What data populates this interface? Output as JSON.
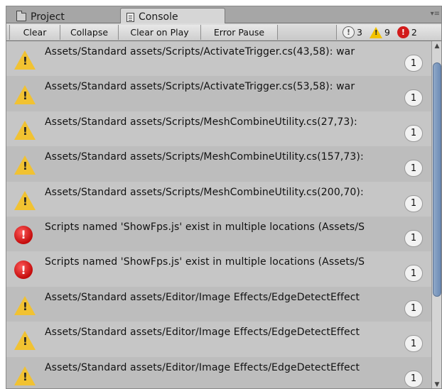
{
  "tabs": {
    "project": "Project",
    "console": "Console",
    "menu_glyph": "▾≡"
  },
  "toolbar": {
    "clear": "Clear",
    "collapse": "Collapse",
    "clear_on_play": "Clear on Play",
    "error_pause": "Error Pause"
  },
  "counts": {
    "info": "3",
    "warning": "9",
    "error": "2"
  },
  "logs": [
    {
      "type": "warning",
      "text": "Assets/Standard assets/Scripts/ActivateTrigger.cs(43,58): war",
      "count": "1"
    },
    {
      "type": "warning",
      "text": "Assets/Standard assets/Scripts/ActivateTrigger.cs(53,58): war",
      "count": "1"
    },
    {
      "type": "warning",
      "text": "Assets/Standard assets/Scripts/MeshCombineUtility.cs(27,73):",
      "count": "1"
    },
    {
      "type": "warning",
      "text": "Assets/Standard assets/Scripts/MeshCombineUtility.cs(157,73):",
      "count": "1"
    },
    {
      "type": "warning",
      "text": "Assets/Standard assets/Scripts/MeshCombineUtility.cs(200,70):",
      "count": "1"
    },
    {
      "type": "error",
      "text": "Scripts named 'ShowFps.js' exist in multiple locations (Assets/S",
      "count": "1"
    },
    {
      "type": "error",
      "text": "Scripts named 'ShowFps.js' exist in multiple locations (Assets/S",
      "count": "1"
    },
    {
      "type": "warning",
      "text": "Assets/Standard assets/Editor/Image Effects/EdgeDetectEffect",
      "count": "1"
    },
    {
      "type": "warning",
      "text": "Assets/Standard assets/Editor/Image Effects/EdgeDetectEffect",
      "count": "1"
    },
    {
      "type": "warning",
      "text": "Assets/Standard assets/Editor/Image Effects/EdgeDetectEffect",
      "count": "1"
    }
  ]
}
